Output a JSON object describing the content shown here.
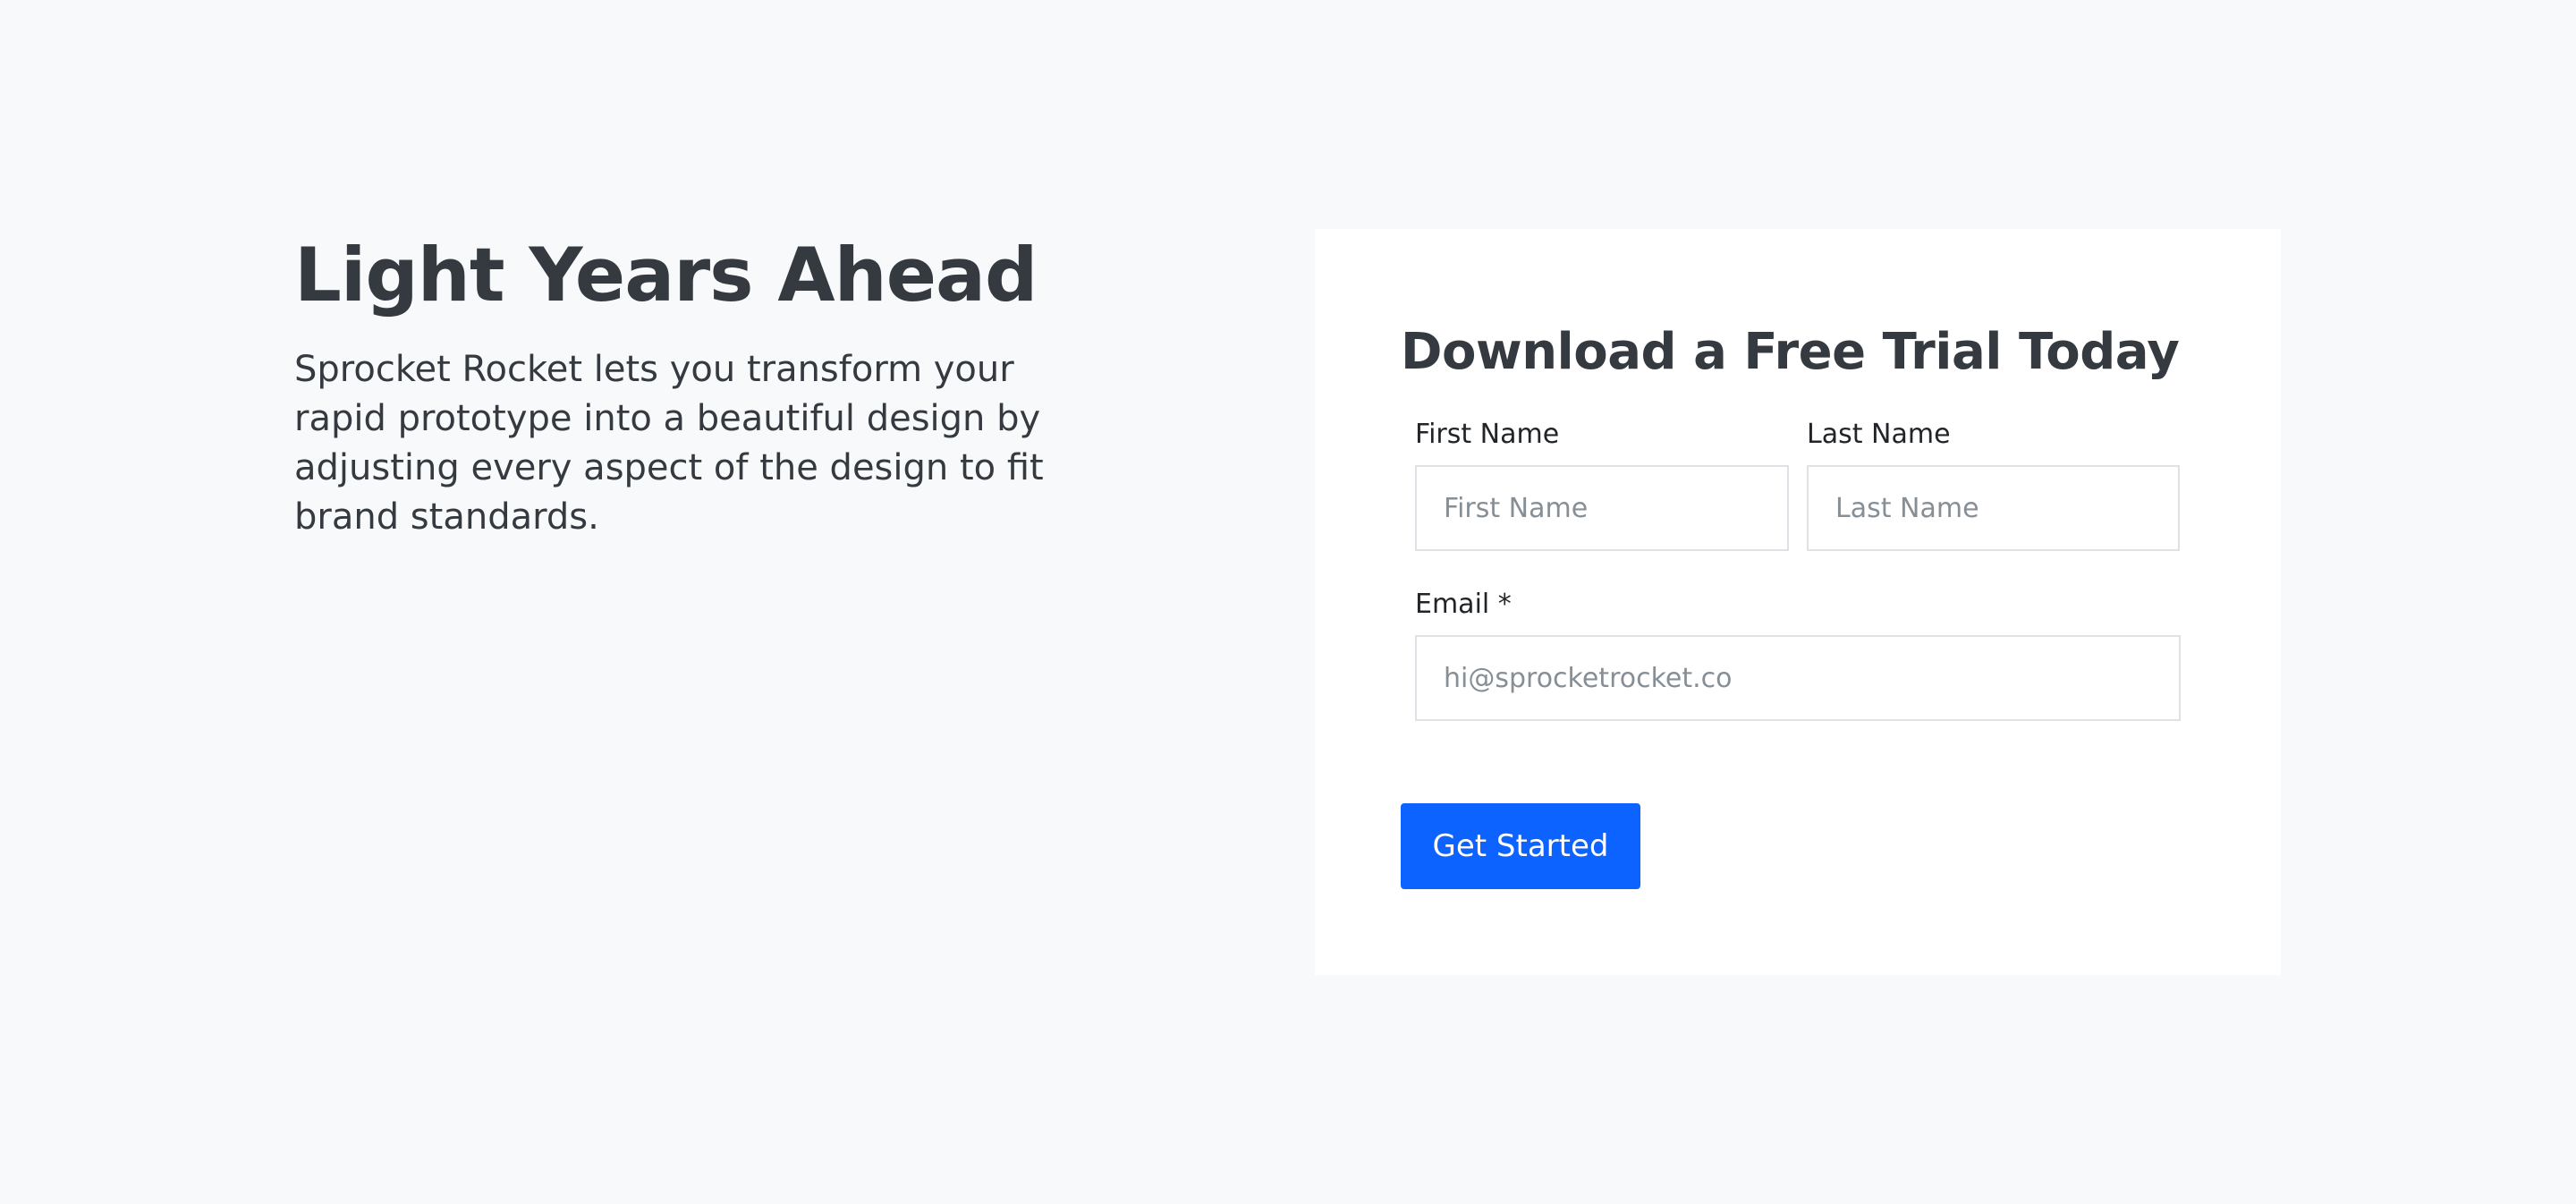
{
  "hero": {
    "title": "Light Years Ahead",
    "description": "Sprocket Rocket lets you transform your rapid prototype into a beautiful design by adjusting every aspect of the design to fit brand standards."
  },
  "form": {
    "title": "Download a Free Trial Today",
    "first_name": {
      "label": "First Name",
      "placeholder": "First Name",
      "value": ""
    },
    "last_name": {
      "label": "Last Name",
      "placeholder": "Last Name",
      "value": ""
    },
    "email": {
      "label": "Email *",
      "placeholder": "hi@sprocketrocket.co",
      "value": ""
    },
    "submit_label": "Get Started"
  },
  "colors": {
    "background": "#f8f9fa",
    "card": "#ffffff",
    "text": "#343a40",
    "accent": "#0d63ff",
    "input_border": "#dee2e6",
    "placeholder": "#868e96"
  }
}
